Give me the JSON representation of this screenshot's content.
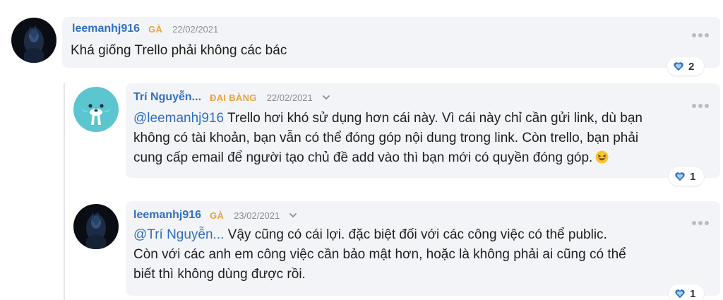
{
  "comments": [
    {
      "username": "leemanhj916",
      "rank": "GÀ",
      "rank_color": "#e8a33c",
      "date": "22/02/2021",
      "mention": "",
      "text": "Khá giống Trello phải không các bác",
      "reaction_count": "2",
      "avatar": "dark-portrait-avatar"
    },
    {
      "username": "Trí Nguyễn...",
      "rank": "ĐẠI BÀNG",
      "rank_color": "#e8a33c",
      "date": "22/02/2021",
      "mention": "@leemanhj916",
      "text_line1": " Trello hơi khó sử dụng hơn cái này. Vì cái này chỉ cần gửi link, dù bạn",
      "text_line2": "không có tài khoản, bạn vẫn có thể đóng góp nội dung trong link. Còn trello, bạn phải",
      "text_line3": "cung cấp email để người tạo chủ đề add vào thì bạn mới có quyền đóng góp.",
      "reaction_count": "1",
      "avatar": "walrus-avatar"
    },
    {
      "username": "leemanhj916",
      "rank": "GÀ",
      "rank_color": "#e8a33c",
      "date": "23/02/2021",
      "mention": "@Trí Nguyễn...",
      "text_line1": " Vậy cũng có cái lợi. đặc biệt đối với các công việc có thể public.",
      "text_line2": "Còn với các anh em công việc cần bảo mật hơn, hoặc là không phải ai cũng có thể",
      "text_line3": "biết thì không dùng được rồi.",
      "reaction_count": "1",
      "avatar": "dark-portrait-avatar"
    }
  ],
  "colors": {
    "accent": "#2f6fc1",
    "bubble": "#f3f4f7",
    "heart": "#2f6fc1",
    "walrus_bg": "#5cc6d0"
  }
}
